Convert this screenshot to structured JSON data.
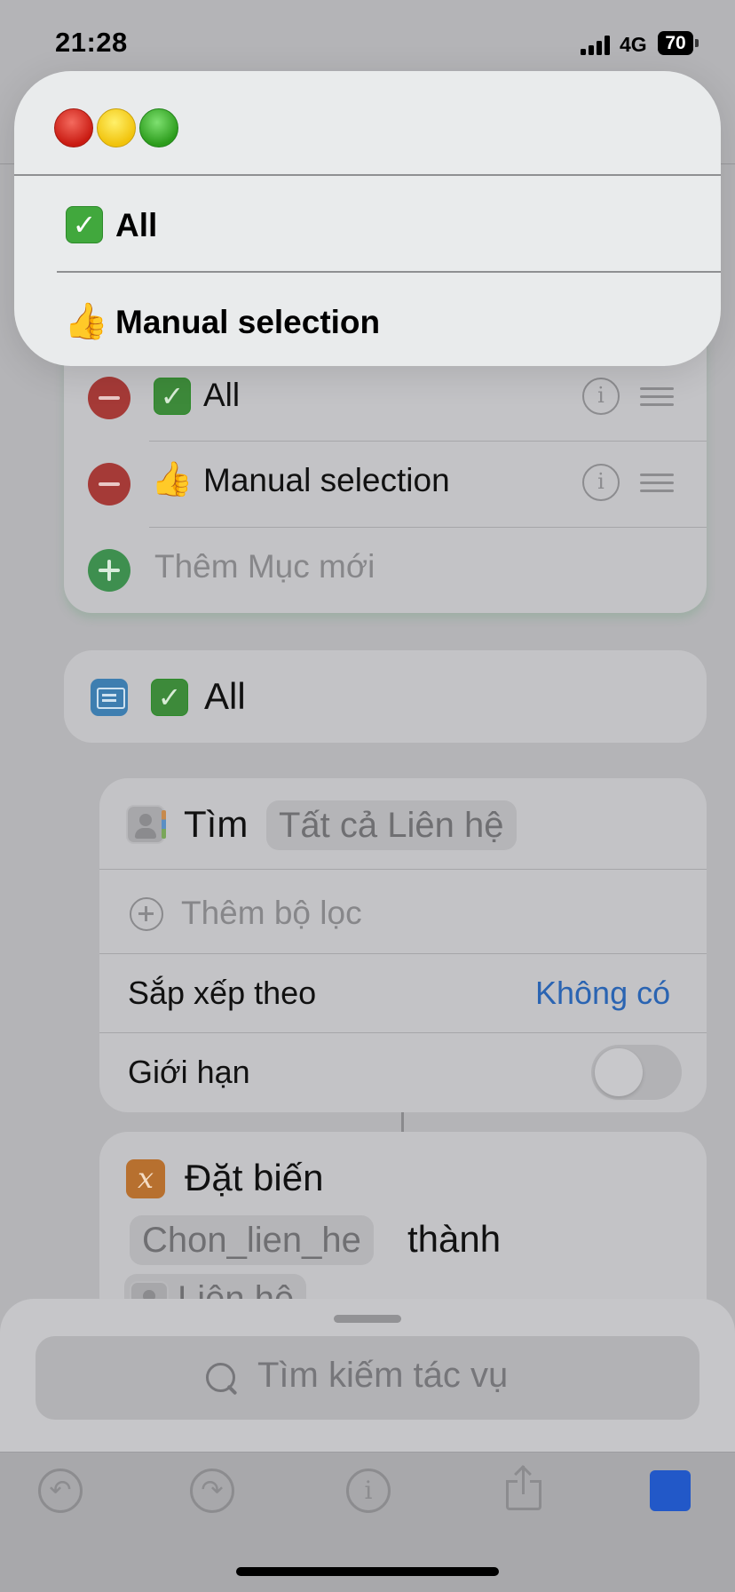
{
  "status_bar": {
    "time": "21:28",
    "network": "4G",
    "battery": "70"
  },
  "popup": {
    "items": [
      {
        "emoji": "✅",
        "label": "All"
      },
      {
        "emoji": "👍",
        "label": "Manual selection"
      }
    ]
  },
  "menu_editor": {
    "items": [
      {
        "emoji": "✅",
        "label": "All"
      },
      {
        "emoji": "👍",
        "label": "Manual selection"
      }
    ],
    "add_placeholder": "Thêm Mục mới"
  },
  "case_block": {
    "emoji": "✅",
    "label": "All"
  },
  "find_action": {
    "verb": "Tìm",
    "target": "Tất cả Liên hệ",
    "add_filter": "Thêm bộ lọc",
    "sort_label": "Sắp xếp theo",
    "sort_value": "Không có",
    "limit_label": "Giới hạn",
    "limit_enabled": false
  },
  "set_variable": {
    "title": "Đặt biến",
    "variable": "Chon_lien_he",
    "to_label": "thành",
    "value": "Liên hệ"
  },
  "search": {
    "placeholder": "Tìm kiếm tác vụ"
  },
  "toolbar": {
    "undo_icon": "undo-icon",
    "redo_icon": "redo-icon",
    "info_icon": "info-icon",
    "share_icon": "share-icon",
    "run_icon": "stop-icon",
    "info_glyph": "i"
  },
  "colors": {
    "run_button": "#2258c8",
    "link": "#2a64b2",
    "remove": "#a53a37",
    "add": "#3e8f4f"
  }
}
